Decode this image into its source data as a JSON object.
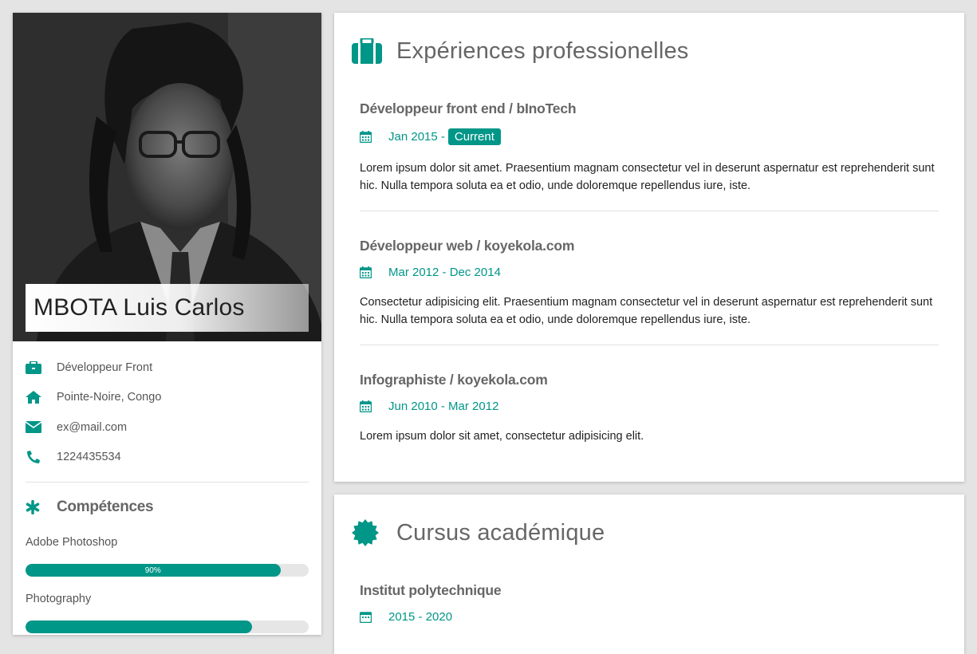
{
  "profile": {
    "name": "MBOTA Luis Carlos",
    "info": [
      {
        "icon": "briefcase-icon",
        "text": "Développeur Front"
      },
      {
        "icon": "home-icon",
        "text": "Pointe-Noire, Congo"
      },
      {
        "icon": "envelope-icon",
        "text": "ex@mail.com"
      },
      {
        "icon": "phone-icon",
        "text": "1224435534"
      }
    ]
  },
  "skills": {
    "title": "Compétences",
    "items": [
      {
        "label": "Adobe Photoshop",
        "percent": 90,
        "percent_label": "90%"
      },
      {
        "label": "Photography",
        "percent": 80,
        "percent_label": ""
      }
    ]
  },
  "experience": {
    "title": "Expériences professionelles",
    "jobs": [
      {
        "title": "Développeur front end / bInoTech",
        "date": "Jan 2015 -",
        "badge": "Current",
        "description": "Lorem ipsum dolor sit amet. Praesentium magnam consectetur vel in deserunt aspernatur est reprehenderit sunt hic. Nulla tempora soluta ea et odio, unde doloremque repellendus iure, iste."
      },
      {
        "title": "Développeur web / koyekola.com",
        "date": "Mar 2012 - Dec 2014",
        "description": "Consectetur adipisicing elit. Praesentium magnam consectetur vel in deserunt aspernatur est reprehenderit sunt hic. Nulla tempora soluta ea et odio, unde doloremque repellendus iure, iste."
      },
      {
        "title": "Infographiste / koyekola.com",
        "date": "Jun 2010 - Mar 2012",
        "description": "Lorem ipsum dolor sit amet, consectetur adipisicing elit."
      }
    ]
  },
  "education": {
    "title": "Cursus académique",
    "items": [
      {
        "title": "Institut polytechnique",
        "date": "2015 - 2020"
      }
    ]
  },
  "colors": {
    "accent": "#009688",
    "background": "#e4e4e4"
  }
}
